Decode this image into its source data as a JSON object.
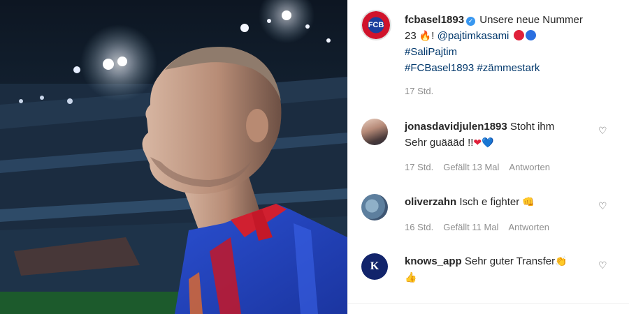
{
  "post": {
    "username": "fcbasel1893",
    "caption_line1": "Unsere neue Nummer",
    "caption_line2a": "23",
    "caption_mention": "@pajtimkasami",
    "hashtag1": "#SaliPajtim",
    "hashtag2": "#FCBasel1893",
    "hashtag3": "#zämmestark",
    "time": "17 Std."
  },
  "comments": [
    {
      "username": "jonasdavidjulen1893",
      "text1": "Stoht ihm",
      "text2": "Sehr guäääd !!",
      "time": "17 Std.",
      "likes": "Gefällt 13 Mal",
      "reply": "Antworten"
    },
    {
      "username": "oliverzahn",
      "text1": "Isch e fighter",
      "time": "16 Std.",
      "likes": "Gefällt 11 Mal",
      "reply": "Antworten"
    },
    {
      "username": "knows_app",
      "text1": "Sehr guter Transfer",
      "avatar_letter": "K"
    }
  ],
  "icons": {
    "verified": "verified-badge-icon",
    "heart": "heart-outline-icon"
  },
  "colors": {
    "link": "#00376b",
    "verified": "#3897f0",
    "muted": "#8e8e8e",
    "basel_red": "#e0203a",
    "basel_blue": "#2b6fe0"
  }
}
